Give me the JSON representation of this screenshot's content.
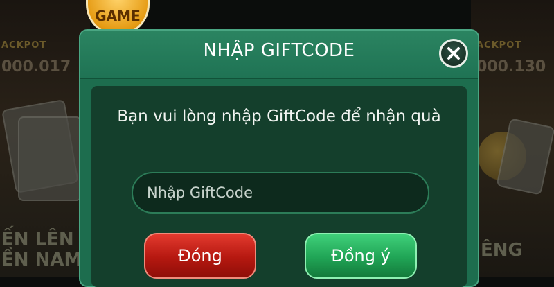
{
  "background": {
    "left_game": {
      "jackpot_label": "ACKPOT",
      "jackpot_value": "000.017",
      "title_line1": "ẾN LÊN",
      "title_line2": "ỀN NAM"
    },
    "right_game": {
      "jackpot_label": "ACKPOT",
      "jackpot_value": "000.130",
      "title": "ÊNG"
    }
  },
  "badge": {
    "label": "GAME"
  },
  "dialog": {
    "title": "NHẬP GIFTCODE",
    "close_icon": "close-icon",
    "message": "Bạn vui lòng nhập GiftCode để nhận quà",
    "input": {
      "placeholder": "Nhập GiftCode",
      "value": ""
    },
    "buttons": {
      "close_label": "Đóng",
      "ok_label": "Đồng ý"
    }
  },
  "colors": {
    "header": "#1f7354",
    "body": "#143f2c",
    "close_button": "#b51810",
    "ok_button": "#20a455"
  }
}
